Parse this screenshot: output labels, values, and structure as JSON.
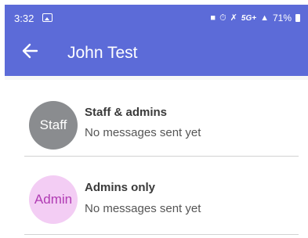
{
  "status_bar": {
    "time": "3:32",
    "network": "5G+",
    "battery": "71%"
  },
  "header": {
    "title": "John Test"
  },
  "conversations": [
    {
      "avatar_text": "Staff",
      "title": "Staff & admins",
      "subtitle": "No messages sent yet"
    },
    {
      "avatar_text": "Admin",
      "title": "Admins only",
      "subtitle": "No messages sent yet"
    }
  ],
  "colors": {
    "app_bar": "#5c6bd8",
    "staff_avatar": "#8a8c8f",
    "admin_avatar_bg": "#f3cdf4",
    "admin_avatar_text": "#b03bb3"
  }
}
